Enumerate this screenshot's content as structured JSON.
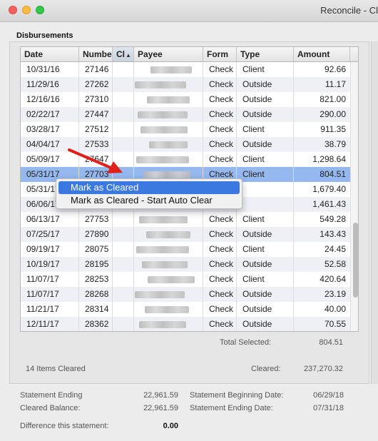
{
  "window": {
    "title": "Reconcile - Cl"
  },
  "section": {
    "title": "Disbursements"
  },
  "columns": [
    {
      "label": "Date"
    },
    {
      "label": "Numbe"
    },
    {
      "label": "Cl"
    },
    {
      "label": "Payee"
    },
    {
      "label": "Form"
    },
    {
      "label": "Type"
    },
    {
      "label": "Amount"
    }
  ],
  "sort_indicator": "▲",
  "rows": [
    {
      "date": "10/31/16",
      "number": "27146",
      "form": "Check",
      "type": "Client",
      "amount": "92.66"
    },
    {
      "date": "11/29/16",
      "number": "27262",
      "form": "Check",
      "type": "Outside",
      "amount": "11.17"
    },
    {
      "date": "12/16/16",
      "number": "27310",
      "form": "Check",
      "type": "Outside",
      "amount": "821.00"
    },
    {
      "date": "02/22/17",
      "number": "27447",
      "form": "Check",
      "type": "Outside",
      "amount": "290.00"
    },
    {
      "date": "03/28/17",
      "number": "27512",
      "form": "Check",
      "type": "Client",
      "amount": "911.35"
    },
    {
      "date": "04/04/17",
      "number": "27533",
      "form": "Check",
      "type": "Outside",
      "amount": "38.79"
    },
    {
      "date": "05/09/17",
      "number": "27647",
      "form": "Check",
      "type": "Client",
      "amount": "1,298.64"
    },
    {
      "date": "05/31/17",
      "number": "27703",
      "form": "Check",
      "type": "Client",
      "amount": "804.51"
    },
    {
      "date": "05/31/17",
      "number": "",
      "form": "",
      "type": "",
      "amount": "1,679.40"
    },
    {
      "date": "06/06/17",
      "number": "",
      "form": "",
      "type": "",
      "amount": "1,461.43"
    },
    {
      "date": "06/13/17",
      "number": "27753",
      "form": "Check",
      "type": "Client",
      "amount": "549.28"
    },
    {
      "date": "07/25/17",
      "number": "27890",
      "form": "Check",
      "type": "Outside",
      "amount": "143.43"
    },
    {
      "date": "09/19/17",
      "number": "28075",
      "form": "Check",
      "type": "Client",
      "amount": "24.45"
    },
    {
      "date": "10/19/17",
      "number": "28195",
      "form": "Check",
      "type": "Outside",
      "amount": "52.58"
    },
    {
      "date": "11/07/17",
      "number": "28253",
      "form": "Check",
      "type": "Client",
      "amount": "420.64"
    },
    {
      "date": "11/07/17",
      "number": "28268",
      "form": "Check",
      "type": "Outside",
      "amount": "23.19"
    },
    {
      "date": "11/21/17",
      "number": "28314",
      "form": "Check",
      "type": "Outside",
      "amount": "40.00"
    },
    {
      "date": "12/11/17",
      "number": "28362",
      "form": "Check",
      "type": "Outside",
      "amount": "70.55"
    }
  ],
  "selected_row_index": 7,
  "context_menu": {
    "items": [
      "Mark as Cleared",
      "Mark as Cleared - Start Auto Clear"
    ]
  },
  "totals": {
    "total_selected_label": "Total Selected:",
    "total_selected_value": "804.51",
    "items_cleared": "14 Items Cleared",
    "cleared_label": "Cleared:",
    "cleared_value": "237,270.32"
  },
  "statement": {
    "ending_label": "Statement Ending",
    "ending_value": "22,961.59",
    "cleared_balance_label": "Cleared Balance:",
    "cleared_balance_value": "22,961.59",
    "beginning_date_label": "Statement Beginning Date:",
    "beginning_date_value": "06/29/18",
    "ending_date_label": "Statement Ending Date:",
    "ending_date_value": "07/31/18",
    "difference_label": "Difference this statement:",
    "difference_value": "0.00"
  },
  "colors": {
    "selection": "#95b8ef",
    "menu_highlight": "#3b78e0",
    "annotation_arrow": "#e0201a"
  }
}
